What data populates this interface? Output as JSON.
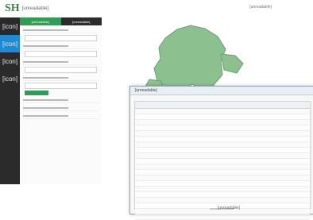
{
  "note": "Placeholders used where source text is unreadable",
  "header": {
    "logo_mark": "SH",
    "title": "[unreadable]",
    "right_link": "[unreadable]"
  },
  "rail": {
    "items": [
      "[icon]",
      "[icon]",
      "[icon]",
      "[icon]"
    ]
  },
  "panel": {
    "tabs": [
      "[unreadable]",
      "[unreadable]"
    ],
    "rows": [
      {
        "label": "[unreadable]"
      },
      {
        "label": "[unreadable]"
      },
      {
        "label": "[unreadable]"
      },
      {
        "label": "[unreadable]"
      },
      {
        "label": "[unreadable]"
      },
      {
        "label": "[unreadable]"
      },
      {
        "label": "[unreadable]"
      },
      {
        "label": "[unreadable]"
      },
      {
        "label": "[unreadable]"
      },
      {
        "label": "[unreadable]"
      },
      {
        "label": "[unreadable]"
      },
      {
        "label": "[unreadable]"
      }
    ]
  },
  "map": {
    "fill_color": "#8cc08e",
    "border_color": "#6f9d73"
  },
  "popup": {
    "title": "[unreadable]",
    "table": {
      "columns": [
        "[unreadable]",
        "[unreadable]",
        "[unreadable]",
        "[unreadable]",
        "[unreadable]",
        "[unreadable]",
        "[unreadable]",
        "[unreadable]",
        "[unreadable]",
        "[unreadable]"
      ],
      "rows": [
        [
          "[unreadable]",
          "[unreadable]",
          "[unreadable]",
          "[unreadable]",
          "[unreadable]",
          "[unreadable]",
          "[unreadable]",
          "[unreadable]",
          "[unreadable]",
          "[unreadable]"
        ],
        [
          "[unreadable]",
          "[unreadable]",
          "[unreadable]",
          "[unreadable]",
          "[unreadable]",
          "[unreadable]",
          "[unreadable]",
          "[unreadable]",
          "[unreadable]",
          "[unreadable]"
        ],
        [
          "[unreadable]",
          "[unreadable]",
          "[unreadable]",
          "[unreadable]",
          "[unreadable]",
          "[unreadable]",
          "[unreadable]",
          "[unreadable]",
          "[unreadable]",
          "[unreadable]"
        ],
        [
          "[unreadable]",
          "[unreadable]",
          "[unreadable]",
          "[unreadable]",
          "[unreadable]",
          "[unreadable]",
          "[unreadable]",
          "[unreadable]",
          "[unreadable]",
          "[unreadable]"
        ],
        [
          "[unreadable]",
          "[unreadable]",
          "[unreadable]",
          "[unreadable]",
          "[unreadable]",
          "[unreadable]",
          "[unreadable]",
          "[unreadable]",
          "[unreadable]",
          "[unreadable]"
        ],
        [
          "[unreadable]",
          "[unreadable]",
          "[unreadable]",
          "[unreadable]",
          "[unreadable]",
          "[unreadable]",
          "[unreadable]",
          "[unreadable]",
          "[unreadable]",
          "[unreadable]"
        ],
        [
          "[unreadable]",
          "[unreadable]",
          "[unreadable]",
          "[unreadable]",
          "[unreadable]",
          "[unreadable]",
          "[unreadable]",
          "[unreadable]",
          "[unreadable]",
          "[unreadable]"
        ],
        [
          "[unreadable]",
          "[unreadable]",
          "[unreadable]",
          "[unreadable]",
          "[unreadable]",
          "[unreadable]",
          "[unreadable]",
          "[unreadable]",
          "[unreadable]",
          "[unreadable]"
        ],
        [
          "[unreadable]",
          "[unreadable]",
          "[unreadable]",
          "[unreadable]",
          "[unreadable]",
          "[unreadable]",
          "[unreadable]",
          "[unreadable]",
          "[unreadable]",
          "[unreadable]"
        ],
        [
          "[unreadable]",
          "[unreadable]",
          "[unreadable]",
          "[unreadable]",
          "[unreadable]",
          "[unreadable]",
          "[unreadable]",
          "[unreadable]",
          "[unreadable]",
          "[unreadable]"
        ],
        [
          "[unreadable]",
          "[unreadable]",
          "[unreadable]",
          "[unreadable]",
          "[unreadable]",
          "[unreadable]",
          "[unreadable]",
          "[unreadable]",
          "[unreadable]",
          "[unreadable]"
        ],
        [
          "[unreadable]",
          "[unreadable]",
          "[unreadable]",
          "[unreadable]",
          "[unreadable]",
          "[unreadable]",
          "[unreadable]",
          "[unreadable]",
          "[unreadable]",
          "[unreadable]"
        ],
        [
          "[unreadable]",
          "[unreadable]",
          "[unreadable]",
          "[unreadable]",
          "[unreadable]",
          "[unreadable]",
          "[unreadable]",
          "[unreadable]",
          "[unreadable]",
          "[unreadable]"
        ],
        [
          "[unreadable]",
          "[unreadable]",
          "[unreadable]",
          "[unreadable]",
          "[unreadable]",
          "[unreadable]",
          "[unreadable]",
          "[unreadable]",
          "[unreadable]",
          "[unreadable]"
        ],
        [
          "[unreadable]",
          "[unreadable]",
          "[unreadable]",
          "[unreadable]",
          "[unreadable]",
          "[unreadable]",
          "[unreadable]",
          "[unreadable]",
          "[unreadable]",
          "[unreadable]"
        ],
        [
          "[unreadable]",
          "[unreadable]",
          "[unreadable]",
          "[unreadable]",
          "[unreadable]",
          "[unreadable]",
          "[unreadable]",
          "[unreadable]",
          "[unreadable]",
          "[unreadable]"
        ],
        [
          "[unreadable]",
          "[unreadable]",
          "[unreadable]",
          "[unreadable]",
          "[unreadable]",
          "[unreadable]",
          "[unreadable]",
          "[unreadable]",
          "[unreadable]",
          "[unreadable]"
        ],
        [
          "[unreadable]",
          "[unreadable]",
          "[unreadable]",
          "[unreadable]",
          "[unreadable]",
          "[unreadable]",
          "[unreadable]",
          "[unreadable]",
          "[unreadable]",
          "[unreadable]"
        ],
        [
          "[unreadable]",
          "[unreadable]",
          "[unreadable]",
          "[unreadable]",
          "[unreadable]",
          "[unreadable]",
          "[unreadable]",
          "[unreadable]",
          "[unreadable]",
          "[unreadable]"
        ],
        [
          "[unreadable]",
          "[unreadable]",
          "[unreadable]",
          "[unreadable]",
          "[unreadable]",
          "[unreadable]",
          "[unreadable]",
          "[unreadable]",
          "[unreadable]",
          "[unreadable]"
        ]
      ]
    },
    "pager_text": "[unreadable]"
  }
}
